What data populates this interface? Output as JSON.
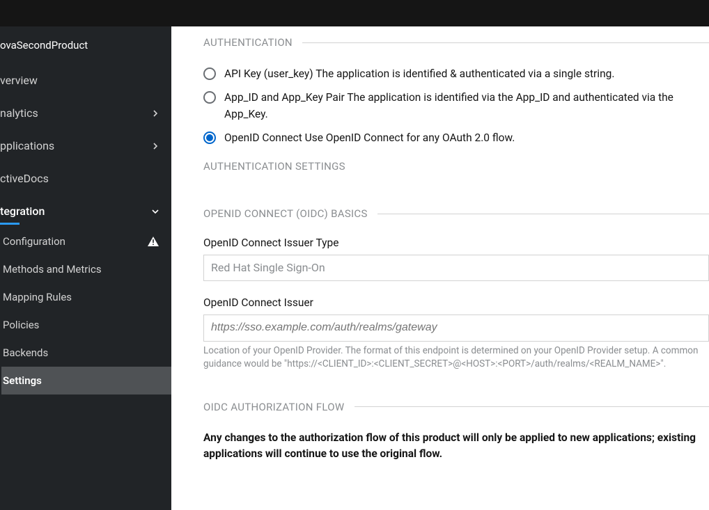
{
  "sidebar": {
    "product_name": "ovaSecondProduct",
    "items": [
      {
        "label": "verview",
        "has_chevron": false
      },
      {
        "label": "nalytics",
        "has_chevron": true
      },
      {
        "label": "pplications",
        "has_chevron": true
      },
      {
        "label": "ctiveDocs",
        "has_chevron": false
      },
      {
        "label": "tegration",
        "has_chevron": true,
        "active": true
      }
    ],
    "integration_sub": [
      {
        "label": "Configuration",
        "warn": true
      },
      {
        "label": "Methods and Metrics"
      },
      {
        "label": "Mapping Rules"
      },
      {
        "label": "Policies"
      },
      {
        "label": "Backends"
      },
      {
        "label": "Settings",
        "current": true
      }
    ]
  },
  "main": {
    "auth_heading": "AUTHENTICATION",
    "auth_options": [
      {
        "text": "API Key (user_key) The application is identified & authenticated via a single string.",
        "selected": false
      },
      {
        "text": "App_ID and App_Key Pair The application is identified via the App_ID and authenticated via the App_Key.",
        "selected": false
      },
      {
        "text": "OpenID Connect Use OpenID Connect for any OAuth 2.0 flow.",
        "selected": true
      }
    ],
    "auth_settings_heading": "AUTHENTICATION SETTINGS",
    "oidc_basics_heading": "OPENID CONNECT (OIDC) BASICS",
    "issuer_type_label": "OpenID Connect Issuer Type",
    "issuer_type_value": "Red Hat Single Sign-On",
    "issuer_label": "OpenID Connect Issuer",
    "issuer_placeholder": "https://sso.example.com/auth/realms/gateway",
    "issuer_help": "Location of your OpenID Provider. The format of this endpoint is determined on your OpenID Provider setup. A common guidance would be \"https://<CLIENT_ID>:<CLIENT_SECRET>@<HOST>:<PORT>/auth/realms/<REALM_NAME>\".",
    "oidc_flow_heading": "OIDC AUTHORIZATION FLOW",
    "flow_note": "Any changes to the authorization flow of this product will only be applied to new applications; existing applications will continue to use the original flow."
  }
}
